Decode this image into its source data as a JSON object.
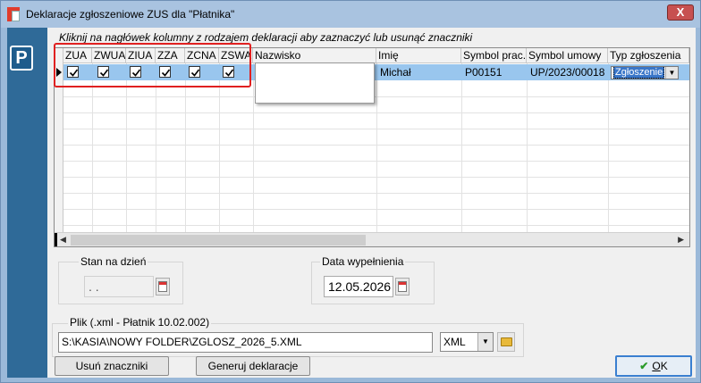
{
  "window": {
    "title": "Deklaracje zgłoszeniowe ZUS dla \"Płatnika\"",
    "close_glyph": "X"
  },
  "side": {
    "logo_letter": "P"
  },
  "hint": "Kliknij na nagłówek kolumny z rodzajem deklaracji aby zaznaczyć lub usunąć znaczniki",
  "grid": {
    "columns": [
      "ZUA",
      "ZWUA",
      "ZIUA",
      "ZZA",
      "ZCNA",
      "ZSWA",
      "Nazwisko",
      "Imię",
      "Symbol prac.",
      "Symbol umowy",
      "Typ zgłoszenia"
    ],
    "row": {
      "checked": [
        true,
        true,
        true,
        true,
        true,
        true
      ],
      "imie": "Michał",
      "symbol_prac": "P00151",
      "symbol_umowy": "UP/2023/00018",
      "typ": "Zgłoszenie"
    }
  },
  "stan_na_dzien": {
    "label": "Stan na dzień",
    "value": ". ."
  },
  "data_wypelnienia": {
    "label": "Data wypełnienia",
    "value": "12.05.2026"
  },
  "plik": {
    "label": "Plik  (.xml - Płatnik 10.02.002)",
    "path": "S:\\KASIA\\NOWY FOLDER\\ZGLOSZ_2026_5.XML",
    "format": "XML"
  },
  "buttons": {
    "clear": "Usuń znaczniki",
    "generate": "Generuj deklaracje",
    "ok_underlined": "O",
    "ok_rest": "K"
  }
}
